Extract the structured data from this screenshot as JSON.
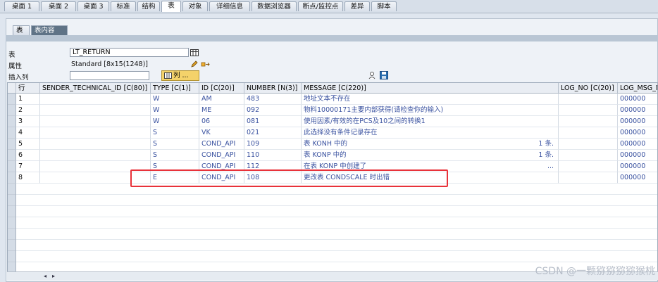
{
  "top_tabs": [
    "桌面 1",
    "桌面 2",
    "桌面 3",
    "标准",
    "结构",
    "表",
    "对象",
    "详细信息",
    "数据浏览器",
    "断点/监控点",
    "差异",
    "脚本"
  ],
  "top_tab_active": "表",
  "sub_tabs": [
    "表",
    "表内容"
  ],
  "sub_tab_active": "表内容",
  "fields": {
    "table_label": "表",
    "table_value": "LT_RETURN",
    "attr_label": "属性",
    "attr_value": "Standard [8x15(1248)]",
    "insert_col_label": "插入列",
    "col_button": "列 ..."
  },
  "columns": [
    "行",
    "SENDER_TECHNICAL_ID [C(80)]",
    "TYPE [C(1)]",
    "ID [C(20)]",
    "NUMBER [N(3)]",
    "MESSAGE [C(220)]",
    "LOG_NO [C(20)]",
    "LOG_MSG_NO"
  ],
  "rows": [
    {
      "n": "1",
      "sender": "",
      "type": "W",
      "id": "AM",
      "number": "483",
      "message": "地址文本不存在",
      "msg_tail": "",
      "log_no": "",
      "log_msg": "000000"
    },
    {
      "n": "2",
      "sender": "",
      "type": "W",
      "id": "ME",
      "number": "092",
      "message": "物料10000171主要内部获得(请检查你的输入)",
      "msg_tail": "",
      "log_no": "",
      "log_msg": "000000"
    },
    {
      "n": "3",
      "sender": "",
      "type": "W",
      "id": "06",
      "number": "081",
      "message": "使用因素/有效的在PCS及10之间的转换1",
      "msg_tail": "",
      "log_no": "",
      "log_msg": "000000"
    },
    {
      "n": "4",
      "sender": "",
      "type": "S",
      "id": "VK",
      "number": "021",
      "message": "此选择没有条件记录存在",
      "msg_tail": "",
      "log_no": "",
      "log_msg": "000000"
    },
    {
      "n": "5",
      "sender": "",
      "type": "S",
      "id": "COND_API",
      "number": "109",
      "message": "表 KONH 中的",
      "msg_tail": "1 条.",
      "log_no": "",
      "log_msg": "000000"
    },
    {
      "n": "6",
      "sender": "",
      "type": "S",
      "id": "COND_API",
      "number": "110",
      "message": "表 KONP 中的",
      "msg_tail": "1 条.",
      "log_no": "",
      "log_msg": "000000"
    },
    {
      "n": "7",
      "sender": "",
      "type": "S",
      "id": "COND_API",
      "number": "112",
      "message": "在表 KONP 中创建了",
      "msg_tail": "...",
      "log_no": "",
      "log_msg": "000000"
    },
    {
      "n": "8",
      "sender": "",
      "type": "E",
      "id": "COND_API",
      "number": "108",
      "message": "更改表 CONDSCALE 时出错",
      "msg_tail": "",
      "log_no": "",
      "log_msg": "000000"
    }
  ],
  "watermark": "CSDN @一颗猕猕猕猕猴桃"
}
